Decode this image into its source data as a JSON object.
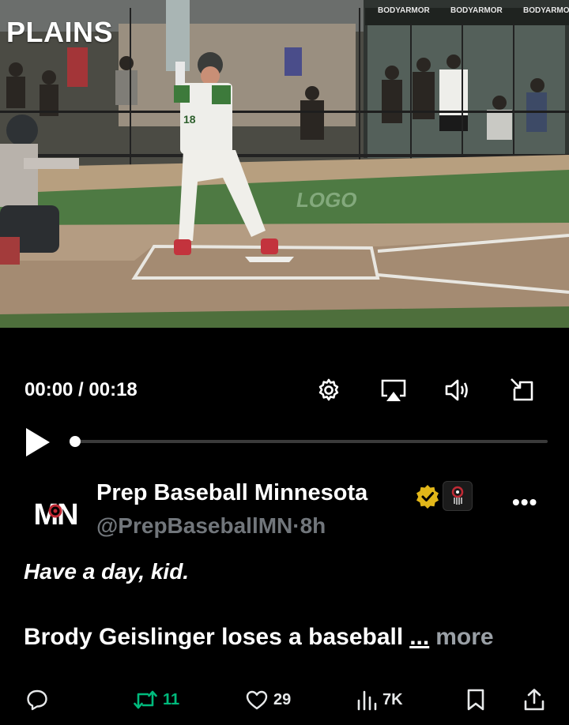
{
  "video": {
    "overlay_logo": "PLAINS",
    "sponsor_banners": [
      "BODYARMOR",
      "BODYARMOR",
      "BODYARMOR"
    ],
    "player_jersey_number": "18",
    "field_text": "LOGO"
  },
  "player_controls": {
    "time_display": "00:00 / 00:18",
    "progress_fraction": 0.0,
    "settings_icon": "gear-icon",
    "airplay_icon": "airplay-icon",
    "volume_icon": "volume-icon",
    "fullscreen_icon": "exit-fullscreen-icon"
  },
  "tweet": {
    "display_name": "Prep Baseball Minnesota",
    "avatar_text": "MN",
    "handle": "@PrepBaseballMN",
    "separator": "·",
    "time_ago": "8h",
    "line1": "Have a day, kid.",
    "line2": "Brody Geislinger loses a baseball",
    "ellipsis": "...",
    "more_label": "more",
    "verified_color": "#e2b719"
  },
  "actions": {
    "reply_count": "",
    "retweet_count": "11",
    "like_count": "29",
    "views_count": "7K",
    "retweet_color": "#00ba7c"
  }
}
